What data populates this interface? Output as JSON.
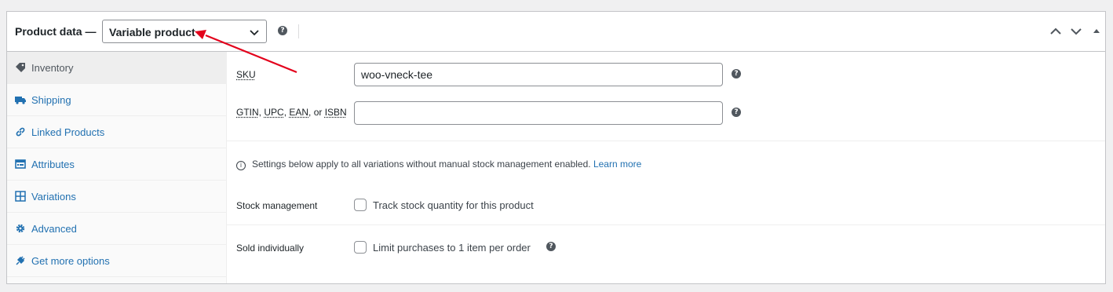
{
  "header": {
    "title": "Product data —",
    "product_type": "Variable product",
    "help": "?"
  },
  "sidebar": {
    "items": [
      {
        "label": "Inventory",
        "icon": "tag-icon",
        "active": true
      },
      {
        "label": "Shipping",
        "icon": "truck-icon",
        "active": false
      },
      {
        "label": "Linked Products",
        "icon": "link-icon",
        "active": false
      },
      {
        "label": "Attributes",
        "icon": "list-icon",
        "active": false
      },
      {
        "label": "Variations",
        "icon": "grid-icon",
        "active": false
      },
      {
        "label": "Advanced",
        "icon": "gear-icon",
        "active": false
      },
      {
        "label": "Get more options",
        "icon": "plugin-icon",
        "active": false
      }
    ]
  },
  "inventory": {
    "sku_label": "SKU",
    "sku_value": "woo-vneck-tee",
    "gtin_label_parts": [
      "GTIN",
      ", ",
      "UPC",
      ", ",
      "EAN",
      ", or ",
      "ISBN"
    ],
    "gtin_value": "",
    "notice_text": "Settings below apply to all variations without manual stock management enabled.",
    "notice_link": "Learn more",
    "stock_label": "Stock management",
    "stock_checkbox_label": "Track stock quantity for this product",
    "sold_label": "Sold individually",
    "sold_checkbox_label": "Limit purchases to 1 item per order",
    "help": "?"
  },
  "colors": {
    "accent": "#2271b1",
    "annotation_arrow": "#e3001b"
  }
}
